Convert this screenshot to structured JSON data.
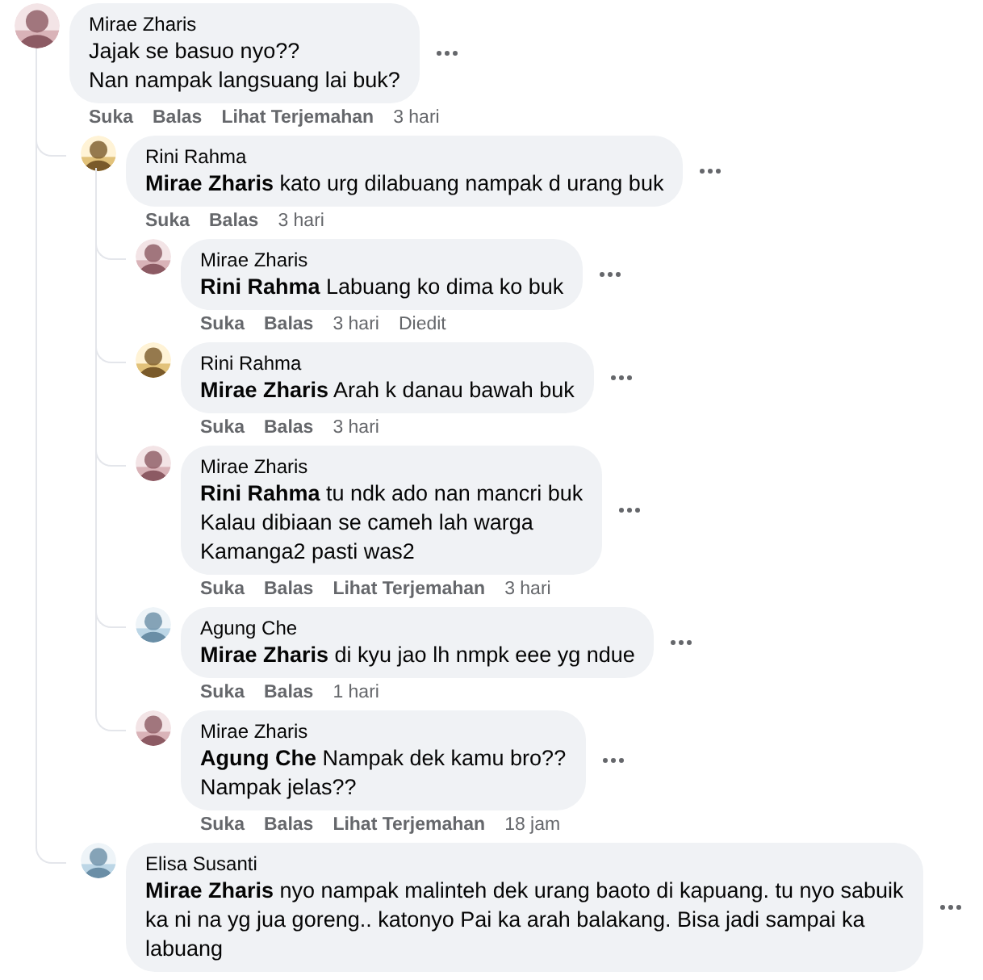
{
  "comments": [
    {
      "author": "Mirae Zharis",
      "lines": [
        "Jajak se basuo nyo??",
        "Nan nampak langsuang lai buk?"
      ],
      "actions": [
        "Suka",
        "Balas",
        "Lihat Terjemahan"
      ],
      "time": "3 hari",
      "children": [
        {
          "author": "Rini Rahma",
          "lines": [
            "**Mirae Zharis** kato urg dilabuang nampak d urang buk"
          ],
          "actions": [
            "Suka",
            "Balas"
          ],
          "time": "3 hari",
          "children": [
            {
              "author": "Mirae Zharis",
              "lines": [
                "**Rini Rahma** Labuang ko dima ko buk"
              ],
              "actions": [
                "Suka",
                "Balas"
              ],
              "time": "3 hari",
              "edited": "Diedit"
            },
            {
              "author": "Rini Rahma",
              "lines": [
                "**Mirae Zharis** Arah k danau bawah buk"
              ],
              "actions": [
                "Suka",
                "Balas"
              ],
              "time": "3 hari"
            },
            {
              "author": "Mirae Zharis",
              "lines": [
                "**Rini Rahma** tu ndk ado nan mancri buk",
                "Kalau dibiaan se cameh lah warga",
                "Kamanga2 pasti was2"
              ],
              "actions": [
                "Suka",
                "Balas",
                "Lihat Terjemahan"
              ],
              "time": "3 hari"
            },
            {
              "author": "Agung Che",
              "lines": [
                "**Mirae Zharis** di kyu jao lh nmpk eee yg ndue"
              ],
              "actions": [
                "Suka",
                "Balas"
              ],
              "time": "1 hari"
            },
            {
              "author": "Mirae Zharis",
              "lines": [
                "**Agung Che** Nampak dek kamu bro??",
                "Nampak jelas??"
              ],
              "actions": [
                "Suka",
                "Balas",
                "Lihat Terjemahan"
              ],
              "time": "18 jam"
            }
          ]
        },
        {
          "author": "Elisa Susanti",
          "lines": [
            "**Mirae Zharis** nyo nampak malinteh dek urang baoto di kapuang. tu nyo sabuik",
            "ka ni na yg jua goreng.. katonyo Pai ka arah balakang. Bisa jadi sampai ka",
            "labuang"
          ]
        }
      ]
    }
  ]
}
